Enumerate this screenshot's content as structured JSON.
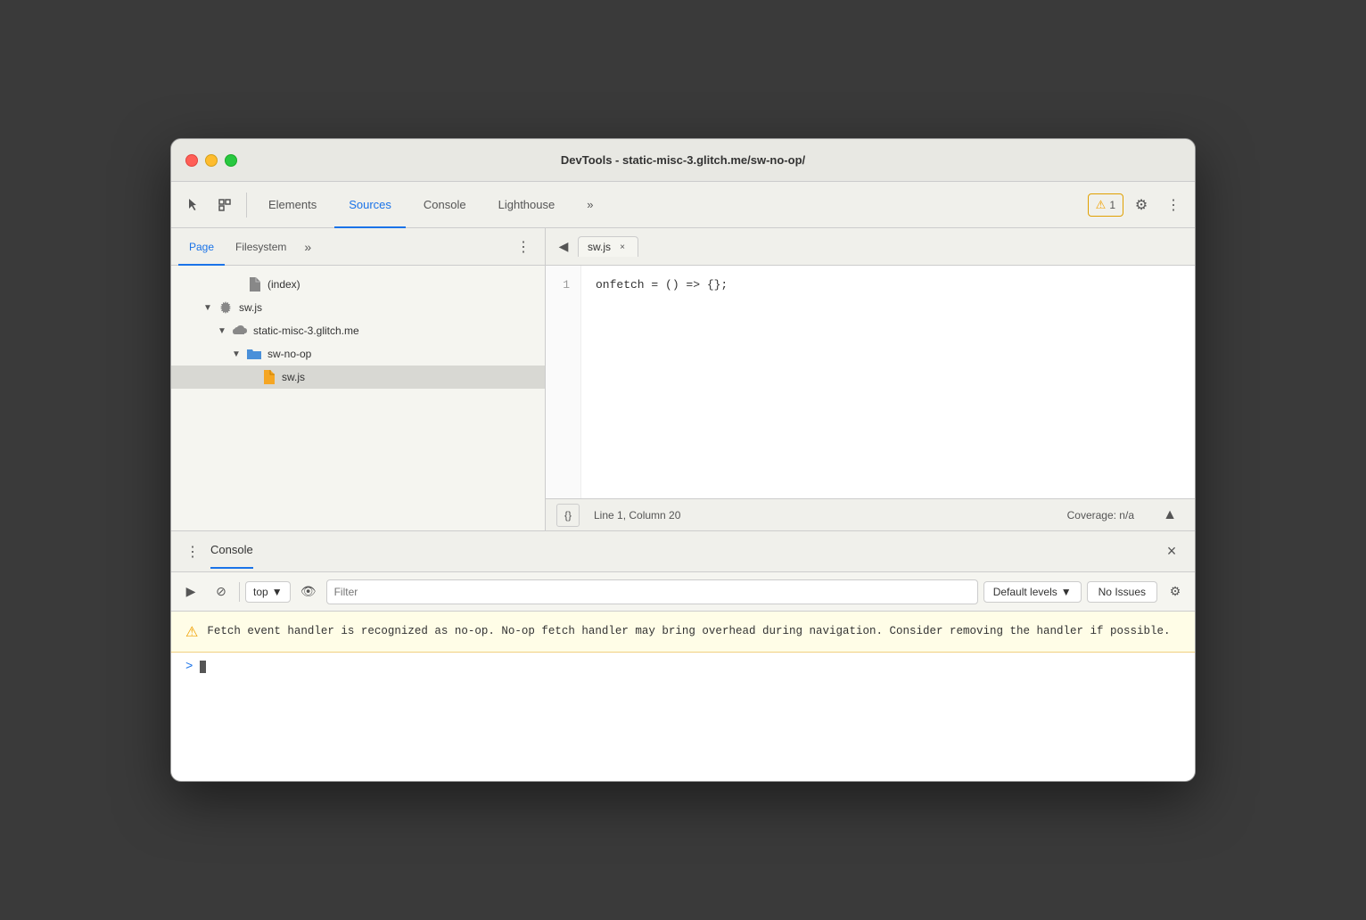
{
  "window": {
    "title": "DevTools - static-misc-3.glitch.me/sw-no-op/"
  },
  "top_toolbar": {
    "tabs": [
      {
        "id": "elements",
        "label": "Elements",
        "active": false
      },
      {
        "id": "sources",
        "label": "Sources",
        "active": true
      },
      {
        "id": "console",
        "label": "Console",
        "active": false
      },
      {
        "id": "lighthouse",
        "label": "Lighthouse",
        "active": false
      }
    ],
    "more_tabs_label": "»",
    "warning_count": "1",
    "gear_label": "⚙",
    "more_label": "⋮"
  },
  "left_panel": {
    "tabs": [
      {
        "id": "page",
        "label": "Page",
        "active": true
      },
      {
        "id": "filesystem",
        "label": "Filesystem",
        "active": false
      }
    ],
    "more_label": "»",
    "menu_label": "⋮",
    "files": [
      {
        "id": "index",
        "label": "(index)",
        "indent": 4,
        "arrow": "",
        "icon": "file",
        "selected": false
      },
      {
        "id": "sw-js-root",
        "label": "sw.js",
        "indent": 2,
        "arrow": "▼",
        "icon": "gear",
        "selected": false
      },
      {
        "id": "domain",
        "label": "static-misc-3.glitch.me",
        "indent": 3,
        "arrow": "▼",
        "icon": "cloud",
        "selected": false
      },
      {
        "id": "folder",
        "label": "sw-no-op",
        "indent": 4,
        "arrow": "▼",
        "icon": "folder",
        "selected": false
      },
      {
        "id": "sw-js-file",
        "label": "sw.js",
        "indent": 5,
        "arrow": "",
        "icon": "js",
        "selected": true
      }
    ]
  },
  "editor": {
    "tab_label": "sw.js",
    "back_btn": "◀",
    "close_btn": "×",
    "code_line_number": "1",
    "code_content": "onfetch = () => {};",
    "status": {
      "format_btn": "{}",
      "position": "Line 1, Column 20",
      "coverage": "Coverage: n/a"
    }
  },
  "console_panel": {
    "menu_label": "⋮",
    "title": "Console",
    "close_label": "×",
    "toolbar": {
      "run_btn": "▶",
      "block_btn": "⊘",
      "context": "top",
      "context_arrow": "▼",
      "eye_btn": "👁",
      "filter_placeholder": "Filter",
      "levels_label": "Default levels",
      "levels_arrow": "▼",
      "no_issues_label": "No Issues",
      "settings_btn": "⚙"
    },
    "warning": {
      "icon": "⚠",
      "text": "Fetch event handler is recognized as no-op. No-op fetch handler may\nbring overhead during navigation. Consider removing the handler if\npossible."
    },
    "prompt": ">"
  }
}
